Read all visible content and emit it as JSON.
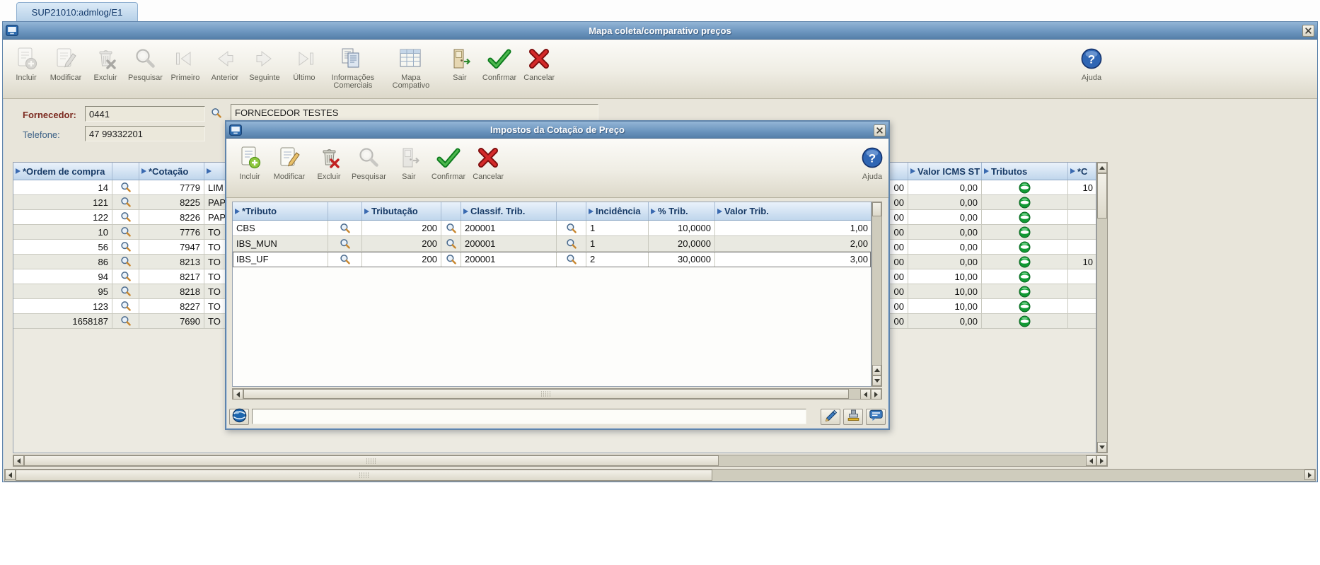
{
  "tab": {
    "label": "SUP21010:admlog/E1"
  },
  "colors": {
    "titlebar_blue": "#6e97c0",
    "grid_header_blue": "#c0d6ec",
    "confirm_green": "#0c7a1c",
    "cancel_red": "#d42a2a",
    "help_blue": "#2f66b4",
    "tributos_green": "#119a34",
    "required_label_red": "#7c2a20",
    "optional_label_blue": "#3c6186"
  },
  "main_window": {
    "title": "Mapa coleta/comparativo preços",
    "help_label": "Ajuda",
    "toolbar": [
      {
        "label": "Incluir",
        "icon": "incluir",
        "disabled": true
      },
      {
        "label": "Modificar",
        "icon": "modificar",
        "disabled": true
      },
      {
        "label": "Excluir",
        "icon": "excluir",
        "disabled": true
      },
      {
        "label": "Pesquisar",
        "icon": "pesquisar",
        "disabled": true
      },
      {
        "label": "Primeiro",
        "icon": "primeiro",
        "disabled": true
      },
      {
        "label": "Anterior",
        "icon": "anterior",
        "disabled": true
      },
      {
        "label": "Seguinte",
        "icon": "seguinte",
        "disabled": true
      },
      {
        "label": "Último",
        "icon": "ultimo",
        "disabled": true
      },
      {
        "label": "Informações Comerciais",
        "icon": "informacoes",
        "disabled": false
      },
      {
        "label": "Mapa Compativo",
        "icon": "mapa",
        "disabled": false
      },
      {
        "label": "Sair",
        "icon": "sair",
        "disabled": false
      },
      {
        "label": "Confirmar",
        "icon": "confirmar",
        "disabled": false
      },
      {
        "label": "Cancelar",
        "icon": "cancelar",
        "disabled": false
      }
    ],
    "form": {
      "fornecedor_label": "Fornecedor:",
      "fornecedor_code": "0441",
      "fornecedor_name": "FORNECEDOR TESTES",
      "telefone_label": "Telefone:",
      "telefone_value": "47 99332201"
    },
    "grid": {
      "headers": [
        {
          "label": "*Ordem de compra",
          "sort": true
        },
        {
          "label": "",
          "sort": false
        },
        {
          "label": "*Cotação",
          "sort": true
        },
        {
          "label": "",
          "sort": true
        },
        {
          "label": "",
          "sort": false
        },
        {
          "label": "Valor ICMS ST",
          "sort": true
        },
        {
          "label": "Tributos",
          "sort": true
        },
        {
          "label": "*C",
          "sort": true
        }
      ],
      "rows": [
        {
          "ordem": "14",
          "cotacao": "7779",
          "desc": "LIM",
          "num": "00",
          "icms": "0,00",
          "tributos_icon": true,
          "c": "10"
        },
        {
          "ordem": "121",
          "cotacao": "8225",
          "desc": "PAP",
          "num": "00",
          "icms": "0,00",
          "tributos_icon": true,
          "c": ""
        },
        {
          "ordem": "122",
          "cotacao": "8226",
          "desc": "PAP",
          "num": "00",
          "icms": "0,00",
          "tributos_icon": true,
          "c": ""
        },
        {
          "ordem": "10",
          "cotacao": "7776",
          "desc": "TO",
          "num": "00",
          "icms": "0,00",
          "tributos_icon": true,
          "c": ""
        },
        {
          "ordem": "56",
          "cotacao": "7947",
          "desc": "TO",
          "num": "00",
          "icms": "0,00",
          "tributos_icon": true,
          "c": ""
        },
        {
          "ordem": "86",
          "cotacao": "8213",
          "desc": "TO",
          "num": "00",
          "icms": "0,00",
          "tributos_icon": true,
          "c": "10"
        },
        {
          "ordem": "94",
          "cotacao": "8217",
          "desc": "TO",
          "num": "00",
          "icms": "10,00",
          "tributos_icon": true,
          "c": ""
        },
        {
          "ordem": "95",
          "cotacao": "8218",
          "desc": "TO",
          "num": "00",
          "icms": "10,00",
          "tributos_icon": true,
          "c": ""
        },
        {
          "ordem": "123",
          "cotacao": "8227",
          "desc": "TO",
          "num": "00",
          "icms": "10,00",
          "tributos_icon": true,
          "c": ""
        },
        {
          "ordem": "1658187",
          "cotacao": "7690",
          "desc": "TO",
          "num": "00",
          "icms": "0,00",
          "tributos_icon": true,
          "c": ""
        }
      ]
    }
  },
  "dialog": {
    "title": "Impostos da Cotação de Preço",
    "help_label": "Ajuda",
    "toolbar": [
      {
        "label": "Incluir",
        "icon": "incluir",
        "disabled": false
      },
      {
        "label": "Modificar",
        "icon": "modificar",
        "disabled": false
      },
      {
        "label": "Excluir",
        "icon": "excluir",
        "disabled": false
      },
      {
        "label": "Pesquisar",
        "icon": "pesquisar",
        "disabled": true
      },
      {
        "label": "Sair",
        "icon": "sair",
        "disabled": true
      },
      {
        "label": "Confirmar",
        "icon": "confirmar",
        "disabled": false
      },
      {
        "label": "Cancelar",
        "icon": "cancelar",
        "disabled": false
      }
    ],
    "grid": {
      "headers": [
        {
          "label": "*Tributo",
          "sort": true
        },
        {
          "label": "",
          "sort": false
        },
        {
          "label": "Tributação",
          "sort": true
        },
        {
          "label": "",
          "sort": false
        },
        {
          "label": "Classif. Trib.",
          "sort": true
        },
        {
          "label": "",
          "sort": false
        },
        {
          "label": "Incidência",
          "sort": true
        },
        {
          "label": "% Trib.",
          "sort": true
        },
        {
          "label": "Valor Trib.",
          "sort": true
        }
      ],
      "rows": [
        {
          "tributo": "CBS",
          "tributacao": "200",
          "classif": "200001",
          "incidencia": "1",
          "perc": "10,0000",
          "valor": "1,00",
          "selected": false
        },
        {
          "tributo": "IBS_MUN",
          "tributacao": "200",
          "classif": "200001",
          "incidencia": "1",
          "perc": "20,0000",
          "valor": "2,00",
          "selected": false
        },
        {
          "tributo": "IBS_UF",
          "tributac<!---->ao": "",
          "tributacao": "200",
          "classif": "200001",
          "incidencia": "2",
          "perc": "30,0000",
          "valor": "3,00",
          "selected": true
        }
      ]
    },
    "status_value": ""
  }
}
